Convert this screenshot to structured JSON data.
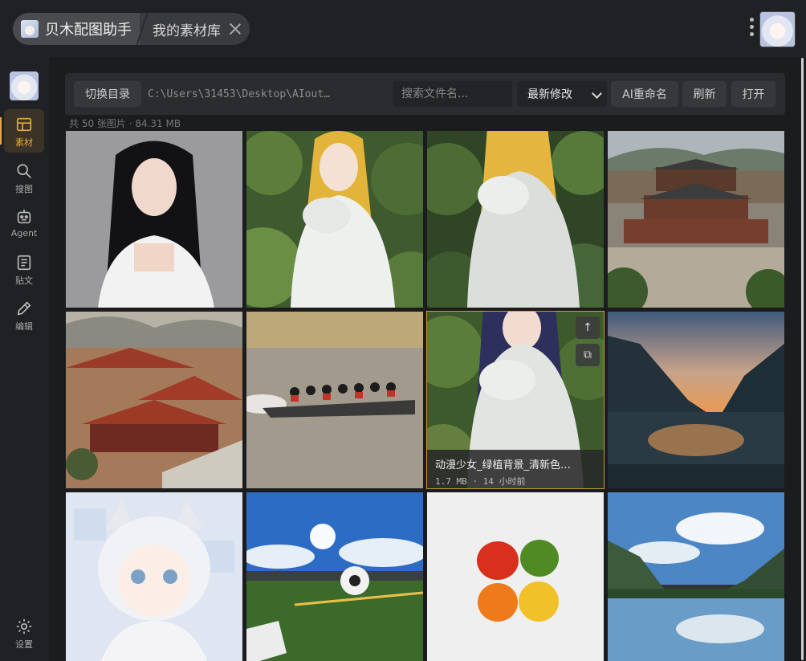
{
  "titlebar": {
    "app_tab": "贝木配图助手",
    "library_tab": "我的素材库"
  },
  "sidebar": {
    "items": [
      {
        "label": "素材",
        "icon": "grid-icon",
        "active": true
      },
      {
        "label": "搜图",
        "icon": "search-icon",
        "active": false
      },
      {
        "label": "Agent",
        "icon": "robot-icon",
        "active": false
      },
      {
        "label": "贴文",
        "icon": "document-icon",
        "active": false
      },
      {
        "label": "编辑",
        "icon": "pencil-icon",
        "active": false
      },
      {
        "label": "设置",
        "icon": "gear-icon",
        "active": false
      }
    ]
  },
  "toolbar": {
    "switch_dir": "切换目录",
    "path": "C:\\Users\\31453\\Desktop\\AIout…",
    "search_placeholder": "搜索文件名...",
    "sort_value": "最新修改",
    "ai_rename": "AI重命名",
    "refresh": "刷新",
    "open": "打开"
  },
  "library": {
    "count_text": "共 50 张图片 · 84.31 MB"
  },
  "tiles": [
    {
      "subject": "portrait-white-dress"
    },
    {
      "subject": "anime-blonde-foliage"
    },
    {
      "subject": "anime-blonde-floral"
    },
    {
      "subject": "temple-aerial"
    },
    {
      "subject": "palace-rooftops"
    },
    {
      "subject": "dragon-boat-race"
    },
    {
      "subject": "anime-girl-foliage",
      "selected": true,
      "name": "动漫少女_绿植背景_清新色…",
      "meta": "1.7 MB · 14 小时前"
    },
    {
      "subject": "mountain-lake-sunset"
    },
    {
      "subject": "anime-cat-girl"
    },
    {
      "subject": "soccer-field"
    },
    {
      "subject": "bell-peppers"
    },
    {
      "subject": "mountain-lake-reflection"
    }
  ]
}
